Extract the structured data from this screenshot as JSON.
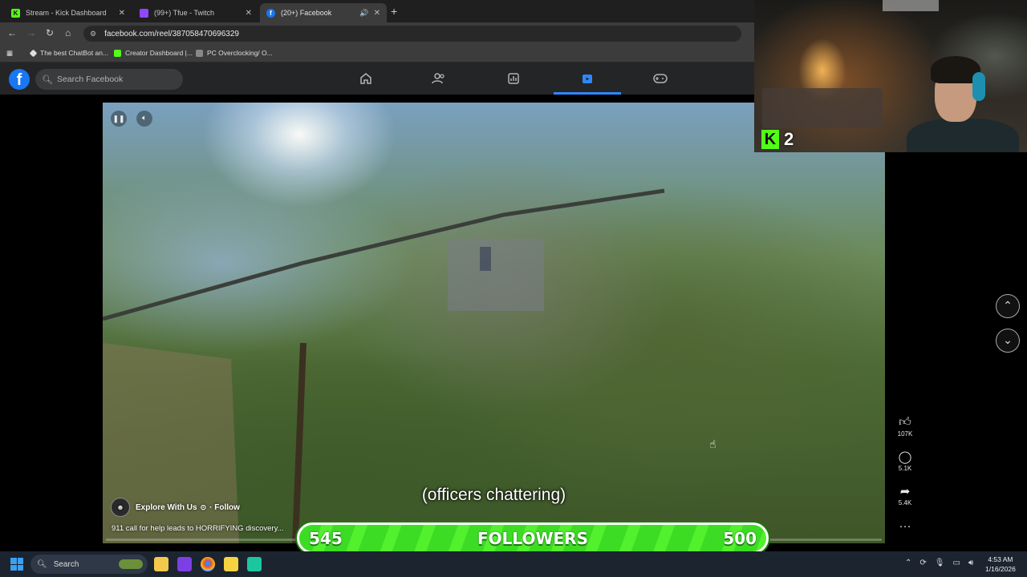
{
  "browser": {
    "tabs": [
      {
        "title": "Stream - Kick Dashboard",
        "favicon_color": "#53fc18",
        "favicon_letter": "K"
      },
      {
        "title": "(99+) Tfue - Twitch",
        "favicon_color": "#9146ff",
        "favicon_letter": ""
      },
      {
        "title": "(20+) Facebook",
        "favicon_color": "#1877f2",
        "favicon_letter": "f"
      }
    ],
    "url": "facebook.com/reel/387058470696329",
    "bookmarks": [
      {
        "label": "The best ChatBot an..."
      },
      {
        "label": "Creator Dashboard |..."
      },
      {
        "label": "PC Overclocking/ O..."
      }
    ]
  },
  "facebook": {
    "logo": "f",
    "search_placeholder": "Search Facebook",
    "nav_icons": [
      "home-icon",
      "friends-icon",
      "feeds-icon",
      "video-icon",
      "gaming-icon"
    ],
    "active_nav": "video-icon"
  },
  "reel": {
    "caption": "(officers chattering)",
    "author": "Explore With Us",
    "follow": "· Follow",
    "description": "911 call for help leads to HORRIFYING discovery...",
    "actions": {
      "likes": "107K",
      "comments": "5.1K",
      "shares": "5.4K"
    }
  },
  "overlay": {
    "kick_count": "2",
    "followers_label": "FOLLOWERS",
    "followers_current": "545",
    "followers_goal": "500"
  },
  "taskbar": {
    "search_label": "Search",
    "time": "4:53 AM",
    "date": "1/16/2026"
  }
}
